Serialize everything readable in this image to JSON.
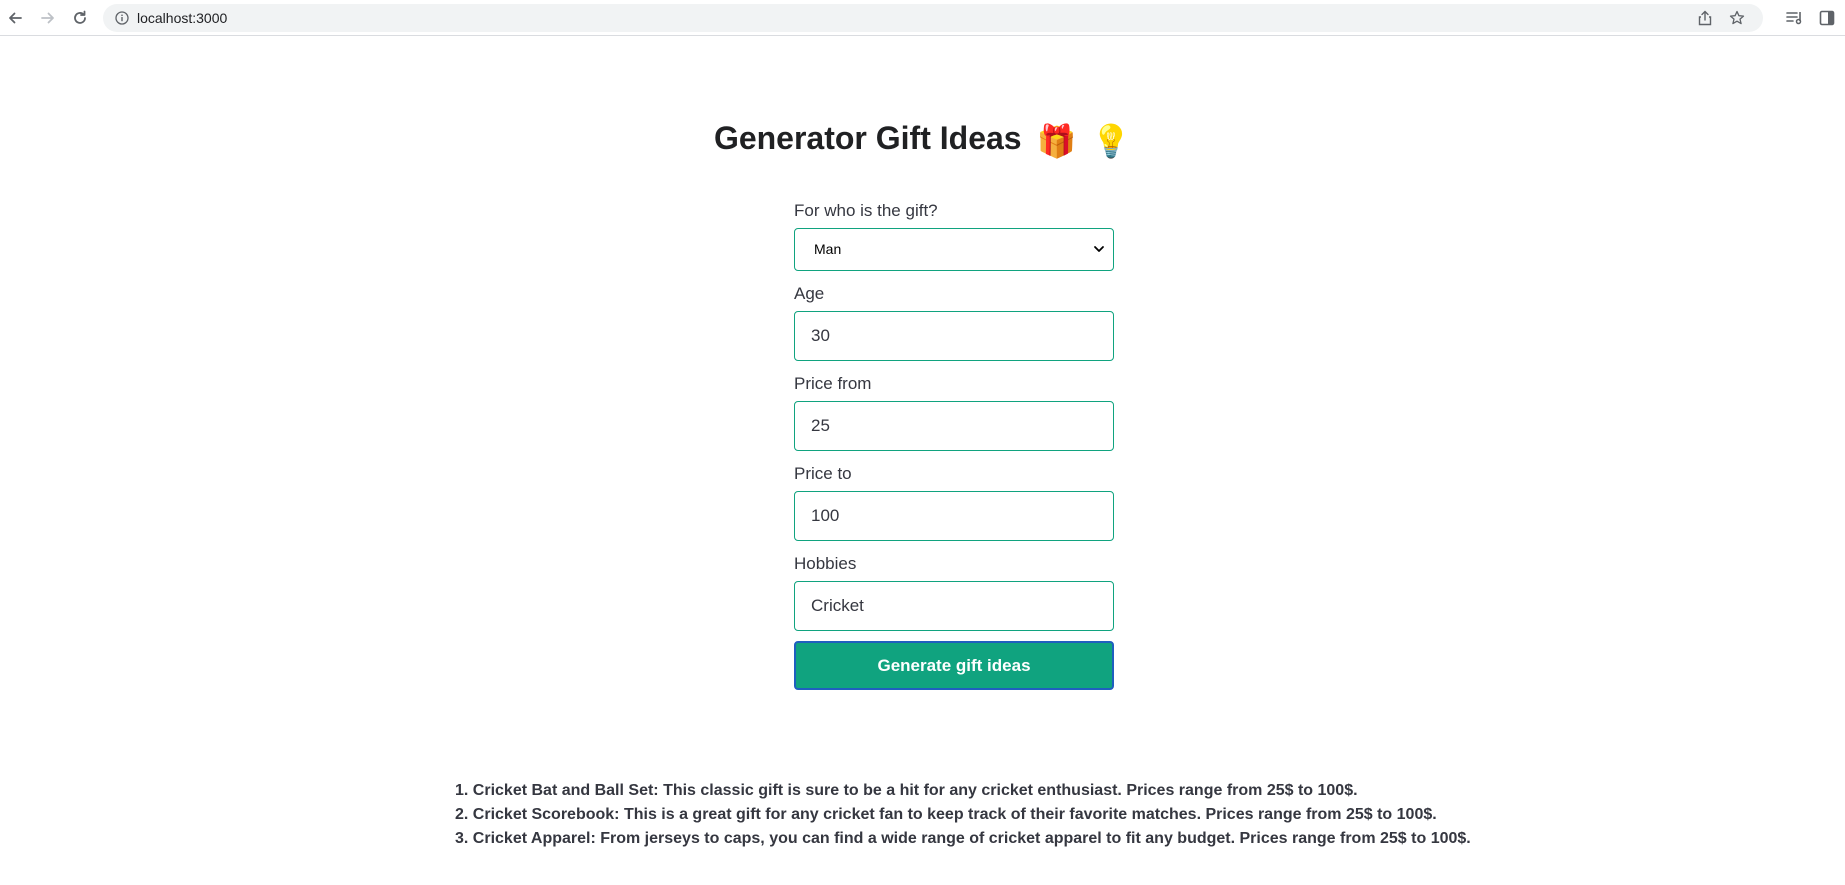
{
  "browser": {
    "url": "localhost:3000",
    "icons": {
      "back": "arrow-left-icon",
      "forward": "arrow-right-icon",
      "reload": "reload-icon",
      "info": "info-icon",
      "share": "share-icon",
      "bookmark": "star-icon",
      "reading_list": "reading-list-icon",
      "side_panel": "side-panel-icon"
    }
  },
  "page": {
    "title": "Generator Gift Ideas",
    "title_emojis": [
      "🎁",
      "💡"
    ]
  },
  "form": {
    "gift_for_label": "For who is the gift?",
    "gift_for_value": "Man",
    "age_label": "Age",
    "age_value": "30",
    "price_from_label": "Price from",
    "price_from_value": "25",
    "price_to_label": "Price to",
    "price_to_value": "100",
    "hobbies_label": "Hobbies",
    "hobbies_value": "Cricket",
    "submit_label": "Generate gift ideas"
  },
  "results": [
    "1. Cricket Bat and Ball Set: This classic gift is sure to be a hit for any cricket enthusiast. Prices range from 25$ to 100$.",
    "2. Cricket Scorebook: This is a great gift for any cricket fan to keep track of their favorite matches. Prices range from 25$ to 100$.",
    "3. Cricket Apparel: From jerseys to caps, you can find a wide range of cricket apparel to fit any budget. Prices range from 25$ to 100$."
  ],
  "colors": {
    "accent": "#10a37f",
    "focus_ring": "#1f5fbf",
    "text": "#353740"
  }
}
